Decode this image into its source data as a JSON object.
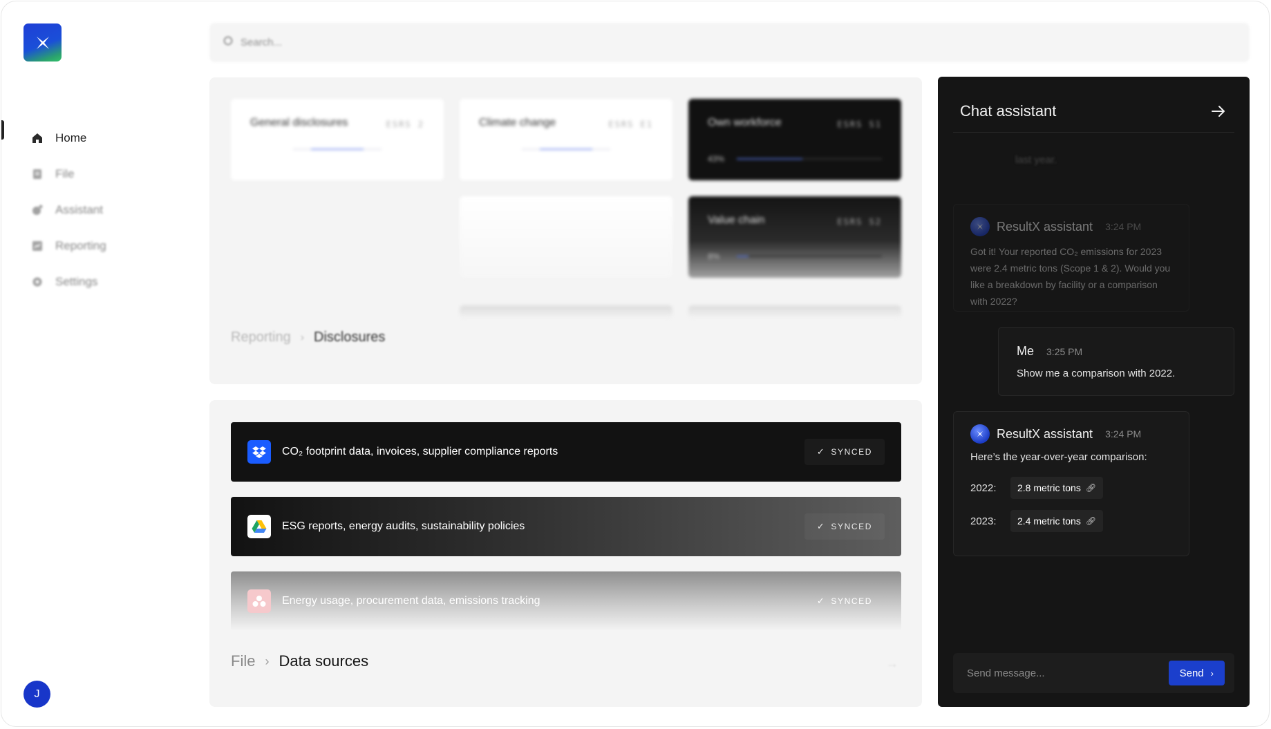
{
  "sidebar": {
    "items": [
      {
        "label": "Home",
        "icon": "home-icon",
        "active": true
      },
      {
        "label": "File",
        "icon": "file-icon"
      },
      {
        "label": "Assistant",
        "icon": "assistant-icon"
      },
      {
        "label": "Reporting",
        "icon": "reporting-icon"
      },
      {
        "label": "Settings",
        "icon": "gear-icon"
      }
    ],
    "avatar_initial": "J"
  },
  "search": {
    "placeholder": "Search..."
  },
  "reporting": {
    "cards": [
      {
        "title": "General disclosures",
        "tag": "ESRS 2"
      },
      {
        "title": "Climate change",
        "tag": "ESRS E1"
      },
      {
        "title": "Own workforce",
        "tag": "ESRS S1",
        "percent": "43%"
      },
      {
        "title": "Value chain",
        "tag": "ESRS S2",
        "percent": "8%"
      }
    ],
    "breadcrumb": {
      "parent": "Reporting",
      "current": "Disclosures"
    }
  },
  "data_sources": {
    "items": [
      {
        "label": "CO₂ footprint data, invoices, supplier compliance reports",
        "status": "SYNCED",
        "icon": "dropbox-icon"
      },
      {
        "label": "ESG reports, energy audits, sustainability policies",
        "status": "SYNCED",
        "icon": "google-drive-icon"
      },
      {
        "label": "Energy usage, procurement data, emissions tracking",
        "status": "SYNCED",
        "icon": "asana-icon"
      }
    ],
    "breadcrumb": {
      "parent": "File",
      "current": "Data sources"
    }
  },
  "chat": {
    "title": "Chat assistant",
    "ghost_text": "last year.",
    "messages": [
      {
        "sender": "ResultX assistant",
        "time": "3:24 PM",
        "text": "Got it! Your reported CO₂ emissions for 2023 were 2.4 metric tons (Scope 1 & 2). Would you like a breakdown by facility or a comparison with 2022?"
      },
      {
        "sender": "Me",
        "time": "3:25 PM",
        "text": "Show me a comparison with 2022."
      },
      {
        "sender": "ResultX assistant",
        "time": "3:24 PM",
        "text": "Here’s the year-over-year comparison:",
        "comparison": [
          {
            "year": "2022:",
            "value": "2.8 metric tons"
          },
          {
            "year": "2023:",
            "value": "2.4 metric tons"
          }
        ]
      }
    ],
    "input_placeholder": "Send message...",
    "send_label": "Send"
  },
  "colors": {
    "accent": "#1b3fcc",
    "dark": "#151515"
  }
}
